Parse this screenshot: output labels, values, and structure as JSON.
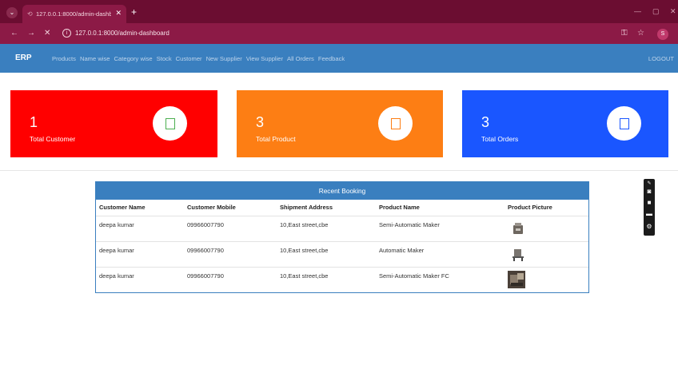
{
  "browser": {
    "tab_title": "127.0.0.1:8000/admin-dashboard",
    "url": "127.0.0.1:8000/admin-dashboard",
    "profile_initial": "S"
  },
  "navbar": {
    "brand": "ERP",
    "links": [
      "Products",
      "Name wise",
      "Category wise",
      "Stock",
      "Customer",
      "New Supplier",
      "View Supplier",
      "All Orders",
      "Feedback"
    ],
    "logout": "LOGOUT"
  },
  "cards": [
    {
      "value": "1",
      "label": "Total Customer",
      "color": "#ff0000",
      "icon_color": "#4caf50"
    },
    {
      "value": "3",
      "label": "Total Product",
      "color": "#fd7e14",
      "icon_color": "#fd7e14"
    },
    {
      "value": "3",
      "label": "Total Orders",
      "color": "#1a56ff",
      "icon_color": "#1a56ff"
    }
  ],
  "recent_booking": {
    "title": "Recent Booking",
    "columns": [
      "Customer Name",
      "Customer Mobile",
      "Shipment Address",
      "Product Name",
      "Product Picture"
    ],
    "rows": [
      {
        "customer": "deepa kumar",
        "mobile": "09966007790",
        "address": "10,East street,cbe",
        "product": "Semi-Automatic Maker"
      },
      {
        "customer": "deepa kumar",
        "mobile": "09966007790",
        "address": "10,East street,cbe",
        "product": "Automatic Maker"
      },
      {
        "customer": "deepa kumar",
        "mobile": "09966007790",
        "address": "10,East street,cbe",
        "product": "Semi-Automatic Maker FC"
      }
    ]
  }
}
